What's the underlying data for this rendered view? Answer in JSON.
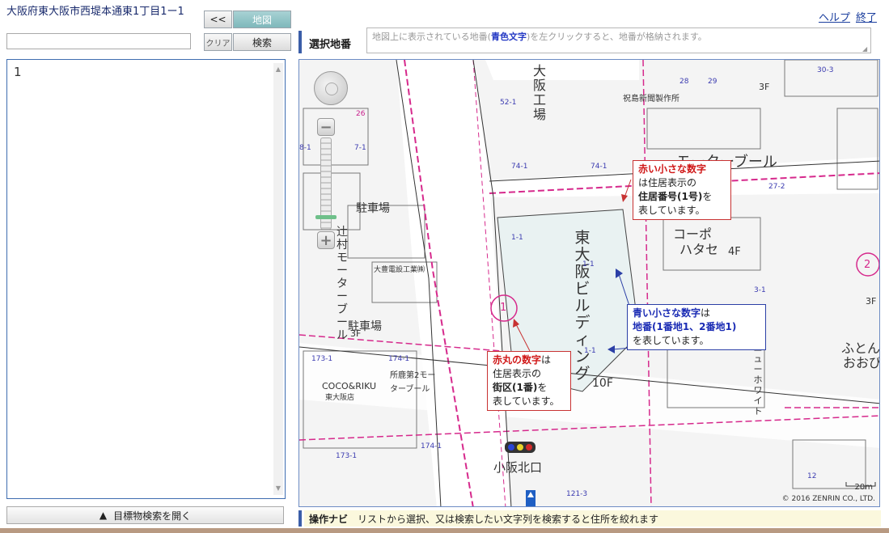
{
  "address": {
    "title": "大阪府東大阪市西堤本通東1丁目1ー1",
    "input_value": ""
  },
  "buttons": {
    "back": "<<",
    "map": "地図",
    "clear": "クリア",
    "search": "検索"
  },
  "result_list": {
    "items": [
      "1"
    ]
  },
  "landmark_button": {
    "arrow": "▲",
    "label": "目標物検索を開く"
  },
  "header_links": {
    "help": "ヘルプ",
    "end": "終了"
  },
  "selected_lot": {
    "label": "選択地番",
    "hint_before": "地図上に表示されている地番(",
    "hint_highlight": "青色文字",
    "hint_after": ")を左クリックすると、地番が格納されます。"
  },
  "map": {
    "labels": {
      "building_main": "東大阪ビルディング",
      "motor_pool_top": "モーターブール",
      "korpo": "コーポ",
      "hatase": "ハタセ",
      "floor_4f": "4F",
      "floor_10f": "10F",
      "floor_3f_a": "3F",
      "floor_3f_b": "3F",
      "floor_3f_c": "3F",
      "parking": "駐車場",
      "parking2": "駐車場",
      "motor_pool_left": "辻村モーターブール",
      "daichu": "大豊電設工業㈱",
      "coco": "COCO&RIKU",
      "coco_sub": "東大阪店",
      "motor_pool_2": "所鹿第2モーターブール",
      "kosaka": "小阪北口",
      "shuppan": "祝島新聞製作所",
      "fudon": "ふとん",
      "oobi": "おおび",
      "newhwite": "ニューホワイト"
    },
    "copyright": "© 2016 ZENRIN CO., LTD.",
    "scale": "20m",
    "circle_1": "1",
    "circle_2": "2",
    "callout_red_small": {
      "l1": "赤い小さな数字",
      "l2": "は住居表示の",
      "l3": "住居番号(1号)",
      "l3b": "を",
      "l4": "表しています。"
    },
    "callout_blue": {
      "l1": "青い小さな数字",
      "l1b": "は",
      "l2": "地番(1番地1、2番地1)",
      "l3": "を表しています。"
    },
    "callout_red_circle": {
      "l1": "赤丸の数字",
      "l1b": "は",
      "l2": "住居表示の",
      "l3": "街区(1番)",
      "l3b": "を",
      "l4": "表しています。"
    },
    "lot_numbers": [
      "52-1",
      "74-1",
      "74-1",
      "1-1",
      "1-1",
      "3-1",
      "27-2",
      "173-1",
      "174-1",
      "121-3",
      "173-1",
      "174-1",
      "30-3",
      "29",
      "28",
      "26",
      "8-1",
      "7-1",
      "12",
      "1-1"
    ]
  },
  "nav": {
    "title": "操作ナビ",
    "text": "リストから選択、又は検索したい文字列を検索すると住所を絞れます"
  }
}
